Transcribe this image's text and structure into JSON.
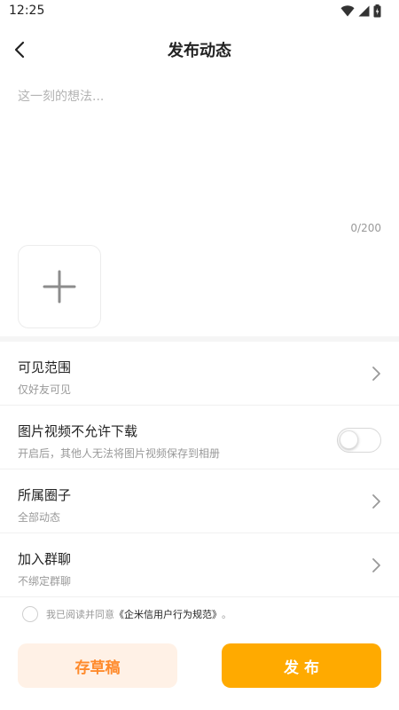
{
  "status_bar": {
    "time": "12:25",
    "icons": [
      "wifi-icon",
      "signal-icon",
      "battery-charging-icon"
    ]
  },
  "header": {
    "back_icon": "chevron-left-icon",
    "title": "发布动态"
  },
  "composer": {
    "placeholder": "这一刻的想法...",
    "value": "",
    "char_count": "0/200",
    "add_media_icon": "plus-icon"
  },
  "settings": {
    "visibility": {
      "title": "可见范围",
      "value": "仅好友可见"
    },
    "no_download": {
      "title": "图片视频不允许下载",
      "desc": "开启后，其他人无法将图片视频保存到相册",
      "enabled": false
    },
    "circle": {
      "title": "所属圈子",
      "value": "全部动态"
    },
    "group_chat": {
      "title": "加入群聊",
      "value": "不绑定群聊"
    }
  },
  "agreement": {
    "prefix": "我已阅读并同意",
    "link": "《企米信用户行为规范》",
    "suffix": "。",
    "checked": false
  },
  "actions": {
    "draft_label": "存草稿",
    "publish_label": "发 布"
  },
  "colors": {
    "accent": "#ffaa00",
    "draft_bg": "#fff1e6",
    "draft_text": "#ff8a2b"
  }
}
